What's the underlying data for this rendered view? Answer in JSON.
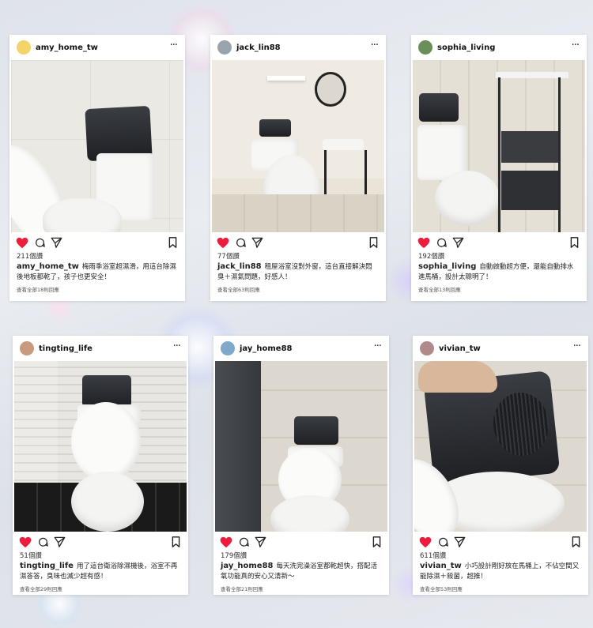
{
  "posts": [
    {
      "username": "amy_home_tw",
      "avatar_color": "#f5d36b",
      "likes": "211個讚",
      "caption": "梅雨季浴室超濕滑，用這台除濕後地板都乾了，孩子也更安全！",
      "comments": "查看全部18則回應"
    },
    {
      "username": "jack_lin88",
      "avatar_color": "#9aa4ad",
      "likes": "77個讚",
      "caption": "租屋浴室沒對外窗，這台直接解決悶臭＋濕氣問題，好感人！",
      "comments": "查看全部63則回應"
    },
    {
      "username": "sophia_living",
      "avatar_color": "#6b8f5a",
      "likes": "192個讚",
      "caption": "自動啟動超方便，還能自動排水進馬桶，設計太聰明了！",
      "comments": "查看全部13則回應"
    },
    {
      "username": "tingting_life",
      "avatar_color": "#c99a7e",
      "likes": "51個讚",
      "caption": "用了這台衛浴除濕機後，浴室不再濕答答，臭味也減少超有感！",
      "comments": "查看全部29則回應"
    },
    {
      "username": "jay_home88",
      "avatar_color": "#7fa9c9",
      "likes": "179個讚",
      "caption": "每天洗完澡浴室都乾超快，搭配活氧功能真的安心又清新～",
      "comments": "查看全部21則回應"
    },
    {
      "username": "vivian_tw",
      "avatar_color": "#b08a8a",
      "likes": "611個讚",
      "caption": "小巧設計剛好放在馬桶上，不佔空間又能除濕＋殺菌，超推！",
      "comments": "查看全部53則回應"
    }
  ],
  "colors": {
    "heart": "#ed1c3c",
    "text": "#222222"
  },
  "icons": [
    "heart-icon",
    "comment-icon",
    "share-icon",
    "bookmark-icon",
    "more-icon"
  ]
}
